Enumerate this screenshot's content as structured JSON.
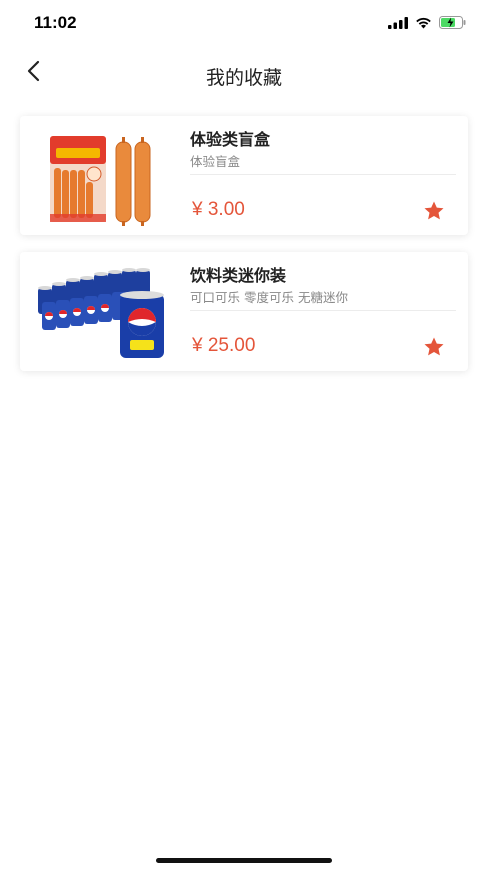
{
  "status": {
    "time": "11:02"
  },
  "nav": {
    "title": "我的收藏"
  },
  "favorites": [
    {
      "title": "体验类盲盒",
      "subtitle": "体验盲盒",
      "price": "¥ 3.00"
    },
    {
      "title": "饮料类迷你装",
      "subtitle": "可口可乐 零度可乐 无糖迷你",
      "price": "¥ 25.00"
    }
  ],
  "colors": {
    "accent": "#e4553a",
    "background": "#ffffff",
    "card": "#ffffff"
  },
  "icons": [
    "back-chevron-icon",
    "signal-icon",
    "wifi-icon",
    "battery-charging-icon",
    "star-filled-icon"
  ]
}
